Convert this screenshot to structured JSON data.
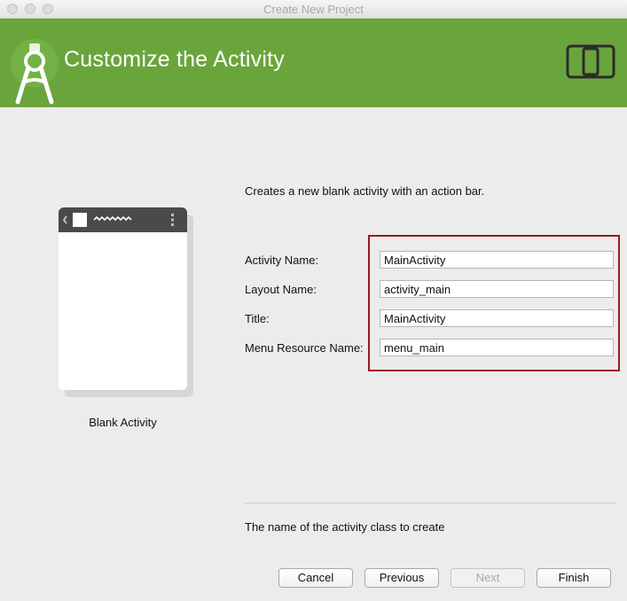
{
  "window": {
    "title": "Create New Project"
  },
  "header": {
    "title": "Customize the Activity",
    "background": "#6aa53c"
  },
  "preview": {
    "label": "Blank Activity"
  },
  "description": "Creates a new blank activity with an action bar.",
  "form": {
    "activity_name": {
      "label": "Activity Name:",
      "value": "MainActivity"
    },
    "layout_name": {
      "label": "Layout Name:",
      "value": "activity_main"
    },
    "title": {
      "label": "Title:",
      "value": "MainActivity"
    },
    "menu_resource_name": {
      "label": "Menu Resource Name:",
      "value": "menu_main"
    }
  },
  "help_text": "The name of the activity class to create",
  "buttons": {
    "cancel": "Cancel",
    "previous": "Previous",
    "next": "Next",
    "finish": "Finish"
  },
  "icons": [
    "android-studio-logo-icon",
    "device-form-factor-icon",
    "overflow-menu-icon"
  ]
}
